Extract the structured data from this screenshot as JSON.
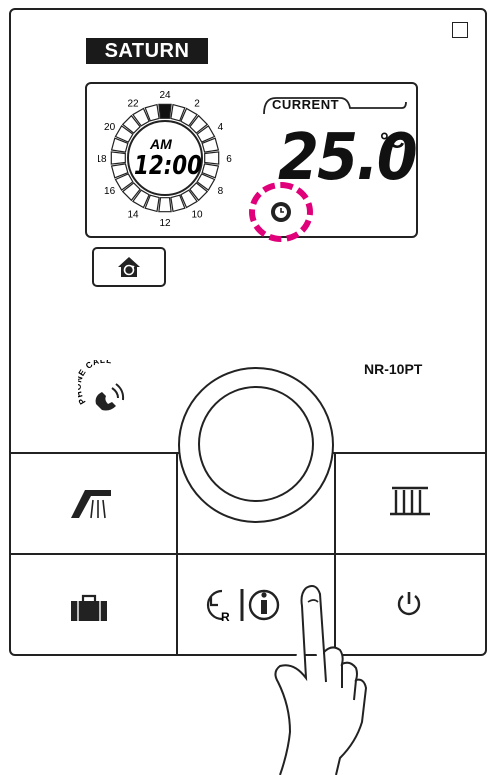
{
  "brand": "SATURN",
  "clock": {
    "period": "AM",
    "time": "12:00",
    "hour_labels": [
      "24",
      "2",
      "4",
      "6",
      "8",
      "10",
      "12",
      "14",
      "16",
      "18",
      "20",
      "22"
    ]
  },
  "current": {
    "label": "CURRENT",
    "temperature": "25.0",
    "unit": "°C"
  },
  "model": "NR-10PT",
  "phone_label": "PHONE CALL",
  "highlight_color": "#e0007a",
  "buttons": {
    "row1": [
      "shower-icon",
      "knob",
      "radiator-icon"
    ],
    "row2": [
      "suitcase-icon",
      "timer-reset-info-icon",
      "power-icon"
    ],
    "timer_reset_letter": "R"
  }
}
